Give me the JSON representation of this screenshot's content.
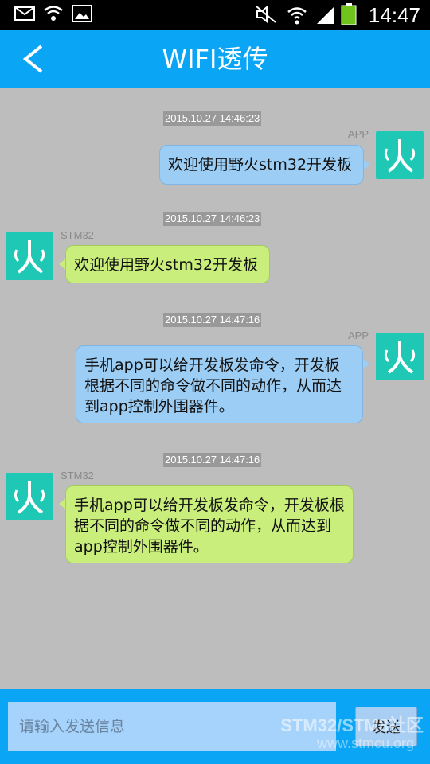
{
  "status_bar": {
    "time": "14:47",
    "icons": [
      "mail-icon",
      "wifi-icon",
      "image-icon",
      "silent-icon",
      "wifi-signal-icon",
      "cell-signal-icon",
      "battery-icon"
    ]
  },
  "header": {
    "back_icon": "chevron-left-icon",
    "title": "WIFI透传",
    "color": "#0aa6f5"
  },
  "messages": [
    {
      "timestamp": "2015.10.27 14:46:23",
      "sender": "APP",
      "side": "right",
      "text": "欢迎使用野火stm32开发板"
    },
    {
      "timestamp": "2015.10.27 14:46:23",
      "sender": "STM32",
      "side": "left",
      "text": "欢迎使用野火stm32开发板"
    },
    {
      "timestamp": "2015.10.27 14:47:16",
      "sender": "APP",
      "side": "right",
      "text": "手机app可以给开发板发命令，开发板根据不同的命令做不同的动作，从而达到app控制外围器件。"
    },
    {
      "timestamp": "2015.10.27 14:47:16",
      "sender": "STM32",
      "side": "left",
      "text": "手机app可以给开发板发命令，开发板根据不同的命令做不同的动作，从而达到app控制外围器件。"
    }
  ],
  "composer": {
    "placeholder": "请输入发送信息",
    "send_label": "发送"
  },
  "watermark": {
    "line1": "STM32/STM8社区",
    "line2": "www.stmcu.org"
  },
  "colors": {
    "app_bubble": "#9ccdf4",
    "stm_bubble": "#c9ee7b",
    "avatar": "#1fc7b5"
  }
}
